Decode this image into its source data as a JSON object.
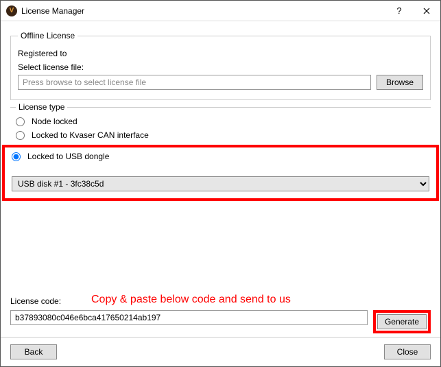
{
  "window": {
    "title": "License Manager",
    "icon_letter": "V"
  },
  "offline": {
    "legend": "Offline License",
    "registered_to_label": "Registered to",
    "select_file_label": "Select license file:",
    "file_placeholder": "Press browse to select license file",
    "browse_label": "Browse"
  },
  "license_type": {
    "legend": "License type",
    "options": {
      "node_locked": "Node locked",
      "kvaser": "Locked to Kvaser CAN interface",
      "usb_dongle": "Locked to USB dongle"
    },
    "selected": "usb_dongle",
    "dongle_select_value": "USB disk #1 - 3fc38c5d"
  },
  "annotation": "Copy & paste below code and send to us",
  "license_code": {
    "label": "License code:",
    "value": "b37893080c046e6bca417650214ab197",
    "generate_label": "Generate"
  },
  "footer": {
    "back_label": "Back",
    "close_label": "Close"
  }
}
